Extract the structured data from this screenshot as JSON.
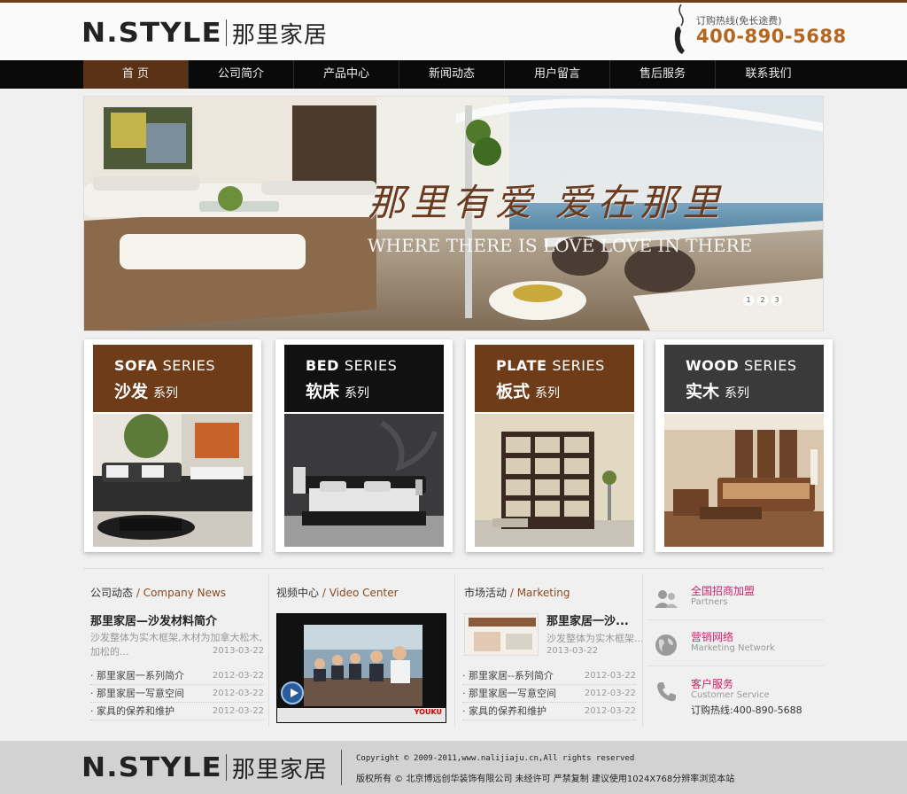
{
  "header": {
    "logo_en": "N.STYLE",
    "logo_cn": "那里家居",
    "hotline_label": "订购热线(免长途费)",
    "hotline_number": "400-890-5688"
  },
  "nav": {
    "items": [
      "首 页",
      "公司简介",
      "产品中心",
      "新闻动态",
      "用户留言",
      "售后服务",
      "联系我们"
    ]
  },
  "banner": {
    "title": "那里有爱 爱在那里",
    "subtitle": "WHERE THERE IS LOVE   LOVE IN THERE",
    "dots": [
      "1",
      "2",
      "3"
    ]
  },
  "series": [
    {
      "en": "SOFA",
      "en_suffix": "SERIES",
      "cn": "沙发",
      "cn_suffix": "系列",
      "color": "#6e3c19"
    },
    {
      "en": "BED",
      "en_suffix": "SERIES",
      "cn": "软床",
      "cn_suffix": "系列",
      "color": "#111111"
    },
    {
      "en": "PLATE",
      "en_suffix": "SERIES",
      "cn": "板式",
      "cn_suffix": "系列",
      "color": "#6e3c19"
    },
    {
      "en": "WOOD",
      "en_suffix": "SERIES",
      "cn": "实木",
      "cn_suffix": "系列",
      "color": "#3a3a3a"
    }
  ],
  "news": {
    "title_cn": "公司动态",
    "title_en": "/ Company News",
    "headline": "那里家居—沙发材料简介",
    "desc": "沙发整体为实木框架,木材为加拿大松木,加松的...",
    "date": "2013-03-22",
    "items": [
      {
        "text": "· 那里家居一系列简介",
        "date": "2012-03-22"
      },
      {
        "text": "· 那里家居一写意空间",
        "date": "2012-03-22"
      },
      {
        "text": "· 家具的保养和维护",
        "date": "2012-03-22"
      }
    ]
  },
  "video": {
    "title_cn": "视频中心",
    "title_en": "/ Video Center",
    "brand": "YOUKU"
  },
  "marketing": {
    "title_cn": "市场活动",
    "title_en": "/ Marketing",
    "headline": "那里家居一沙...",
    "desc": "沙发整体为实木框架...",
    "date": "2013-03-22",
    "items": [
      {
        "text": "· 那里家居--系列简介",
        "date": "2012-03-22"
      },
      {
        "text": "· 那里家居一写意空间",
        "date": "2012-03-22"
      },
      {
        "text": "· 家具的保养和维护",
        "date": "2012-03-22"
      }
    ]
  },
  "side": {
    "partners_title": "全国招商加盟",
    "partners_sub": "Partners",
    "network_title": "营销网络",
    "network_sub": "Marketing Network",
    "service_title": "客户服务",
    "service_sub": "Customer Service",
    "service_line": "订购热线:400-890-5688"
  },
  "footer": {
    "logo_en": "N.STYLE",
    "logo_cn": "那里家居",
    "copyright": "Copyright © 2009-2011,www.nalijiaju.cn,All rights reserved",
    "rights": "版权所有 © 北京博远创华装饰有限公司 未经许可 严禁复制 建议使用1024X768分辨率浏览本站"
  }
}
